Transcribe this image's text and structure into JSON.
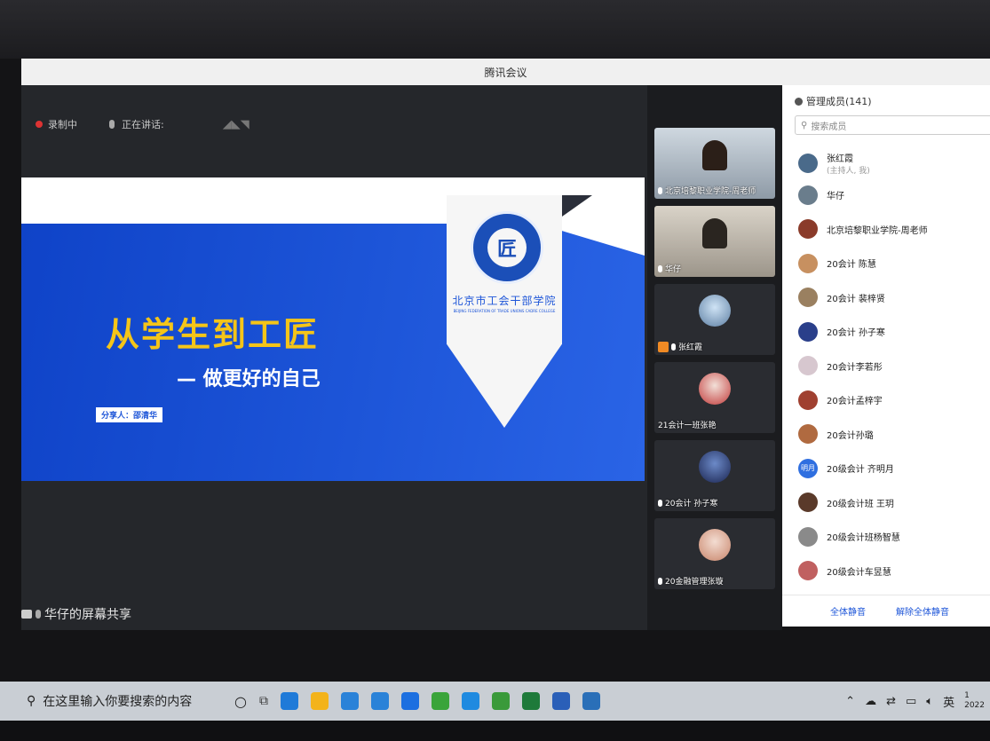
{
  "window": {
    "title": "腾讯会议"
  },
  "stage": {
    "recording": "录制中",
    "speaking": "正在讲话:",
    "share_label": "华仔的屏幕共享"
  },
  "slide": {
    "title": "从学生到工匠",
    "subtitle": "— 做更好的自己",
    "presenter": "分享人：邵清华",
    "school_name": "北京市工会干部学院",
    "school_en": "BEIJING FEDERATION OF TRADE UNIONS CADRE COLLEGE",
    "badge_glyph": "匠"
  },
  "videos": [
    {
      "label": "北京培黎职业学院-周老师"
    },
    {
      "label": "华仔"
    },
    {
      "label": "张红霞"
    },
    {
      "label": "21会计一班张艳"
    },
    {
      "label": "20会计 孙子寒"
    },
    {
      "label": "20金融管理张璇"
    }
  ],
  "members_panel": {
    "title": "管理成员(141)",
    "search_placeholder": "搜索成员",
    "members": [
      {
        "name": "张红霞",
        "sub": "(主持人, 我)",
        "color": "#4a6a8a"
      },
      {
        "name": "华仔",
        "sub": "",
        "color": "#6a7d8c"
      },
      {
        "name": "北京培黎职业学院-周老师",
        "sub": "",
        "color": "#8a3b2a"
      },
      {
        "name": "20会计 陈慧",
        "sub": "",
        "color": "#c79060"
      },
      {
        "name": "20会计 裴梓贤",
        "sub": "",
        "color": "#9a8060"
      },
      {
        "name": "20会计 孙子寒",
        "sub": "",
        "color": "#2a3f8a"
      },
      {
        "name": "20会计李若彤",
        "sub": "",
        "color": "#d7c7cf"
      },
      {
        "name": "20会计孟梓宇",
        "sub": "",
        "color": "#a04030"
      },
      {
        "name": "20会计孙璐",
        "sub": "",
        "color": "#b06a40"
      },
      {
        "name": "20级会计 齐明月",
        "sub": "",
        "color": "#2f6fe0",
        "initials": "明月"
      },
      {
        "name": "20级会计班 王玥",
        "sub": "",
        "color": "#5a3a2a"
      },
      {
        "name": "20级会计班杨智慧",
        "sub": "",
        "color": "#8a8a8a"
      },
      {
        "name": "20级会计车昱慧",
        "sub": "",
        "color": "#c06060"
      }
    ],
    "mute_all": "全体静音",
    "unmute_all": "解除全体静音"
  },
  "taskbar": {
    "search_text": "在这里输入你要搜索的内容",
    "tray_lang": "英",
    "clock_time": "1",
    "clock_date": "2022",
    "app_icon_colors": [
      "#1f7ad8",
      "#f3b31b",
      "#2a82d8",
      "#2a82d8",
      "#1c6fe0",
      "#3aa43a",
      "#1f8ae0",
      "#3a9a3a",
      "#1e7a3a",
      "#2a5fb8",
      "#2a6fb8"
    ]
  }
}
